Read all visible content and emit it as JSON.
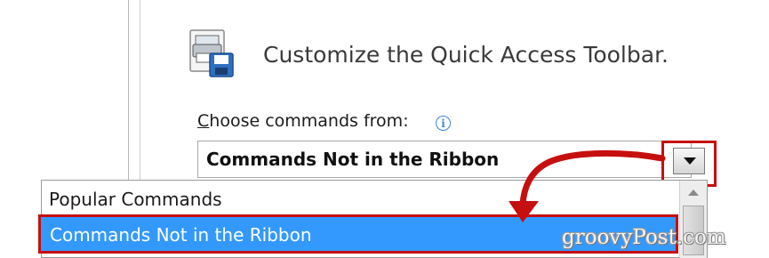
{
  "header": {
    "title": "Customize the Quick Access Toolbar.",
    "icon": "qat-printer-disk-icon"
  },
  "choose": {
    "label_accesskey": "C",
    "label_rest": "hoose commands from:",
    "info_icon": "info-icon",
    "info_glyph": "i"
  },
  "select": {
    "value": "Commands Not in the Ribbon",
    "button_icon": "chevron-down-icon"
  },
  "dropdown": {
    "items": [
      {
        "label": "Popular Commands",
        "selected": false
      },
      {
        "label": "Commands Not in the Ribbon",
        "selected": true
      }
    ]
  },
  "annotations": {
    "highlight_color": "#c60f0f",
    "selection_color": "#3399ff"
  },
  "watermark": {
    "text": "groovyPost.com"
  }
}
